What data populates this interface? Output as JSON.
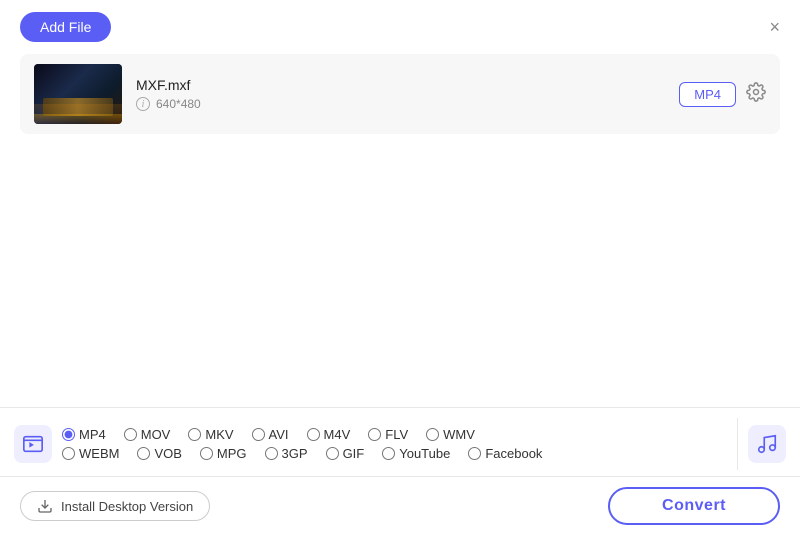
{
  "header": {
    "add_file_label": "Add File",
    "close_icon": "×"
  },
  "file_item": {
    "name": "MXF.mxf",
    "resolution": "640*480",
    "format": "MP4"
  },
  "format_options": {
    "row1": [
      {
        "id": "mp4",
        "label": "MP4",
        "checked": true
      },
      {
        "id": "mov",
        "label": "MOV",
        "checked": false
      },
      {
        "id": "mkv",
        "label": "MKV",
        "checked": false
      },
      {
        "id": "avi",
        "label": "AVI",
        "checked": false
      },
      {
        "id": "m4v",
        "label": "M4V",
        "checked": false
      },
      {
        "id": "flv",
        "label": "FLV",
        "checked": false
      },
      {
        "id": "wmv",
        "label": "WMV",
        "checked": false
      }
    ],
    "row2": [
      {
        "id": "webm",
        "label": "WEBM",
        "checked": false
      },
      {
        "id": "vob",
        "label": "VOB",
        "checked": false
      },
      {
        "id": "mpg",
        "label": "MPG",
        "checked": false
      },
      {
        "id": "3gp",
        "label": "3GP",
        "checked": false
      },
      {
        "id": "gif",
        "label": "GIF",
        "checked": false
      },
      {
        "id": "youtube",
        "label": "YouTube",
        "checked": false
      },
      {
        "id": "facebook",
        "label": "Facebook",
        "checked": false
      }
    ]
  },
  "footer": {
    "install_label": "Install Desktop Version",
    "convert_label": "Convert"
  }
}
